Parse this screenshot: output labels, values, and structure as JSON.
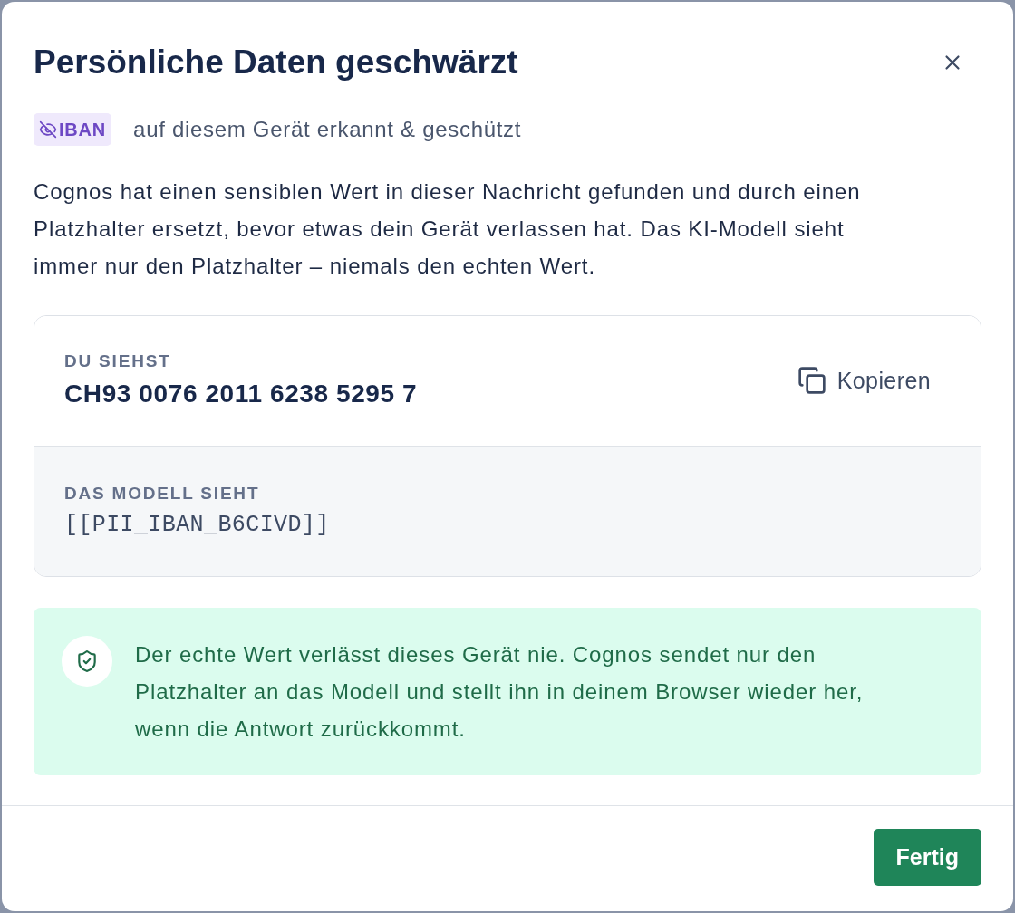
{
  "dialog": {
    "title": "Persönliche Daten geschwärzt",
    "detection": {
      "badge": "IBAN",
      "caption": "auf diesem Gerät erkannt & geschützt"
    },
    "description": "Cognos hat einen sensiblen Wert in dieser Nachricht gefunden und durch einen Platzhalter ersetzt, bevor etwas dein Gerät verlassen hat. Das KI-Modell sieht immer nur den Platzhalter – niemals den echten Wert.",
    "comparison": [
      {
        "kind": "original",
        "label": "DU SIEHST",
        "value": "CH93 0076 2011 6238 5295 7",
        "copy_button": "Kopieren"
      },
      {
        "kind": "placeholder",
        "label": "DAS MODELL SIEHT",
        "value": "[[PII_IBAN_B6CIVD]]"
      }
    ],
    "notice": {
      "text": "Der echte Wert verlässt dieses Gerät nie. Cognos sendet nur den Platzhalter an das Modell und stellt ihn in deinem Browser wieder her, wenn die Antwort zurückkommt."
    },
    "footer": {
      "buttons": [
        "Fertig"
      ]
    }
  }
}
